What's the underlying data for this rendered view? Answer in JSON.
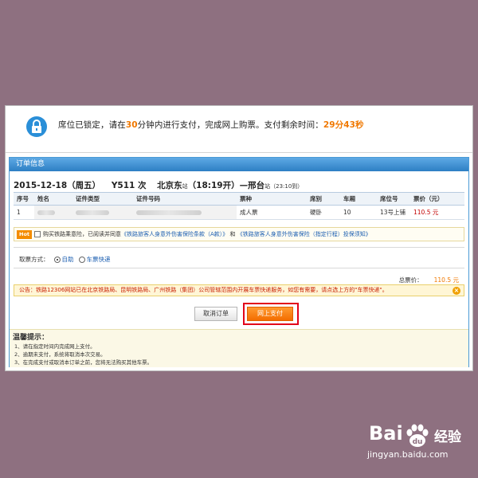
{
  "banner": {
    "text_before": "席位已锁定，请在",
    "minutes": "30",
    "text_after": "分钟内进行支付，完成网上购票。支付剩余时间：",
    "remaining": "29分43秒"
  },
  "panel": {
    "header": "订单信息"
  },
  "train": {
    "date": "2015-12-18（周五）",
    "number": "Y511 次",
    "from": "北京东",
    "from_suffix": "站",
    "depart": "（18:19开）",
    "dash": "—",
    "to": "邢台",
    "to_suffix": "站",
    "arrive": "（23:10到）"
  },
  "table": {
    "headers": [
      "序号",
      "姓名",
      "证件类型",
      "证件号码",
      "票种",
      "席别",
      "车厢",
      "席位号",
      "票价（元）"
    ],
    "row": {
      "index": "1",
      "ticket_type": "成人票",
      "seat_class": "硬卧",
      "car": "10",
      "seat_no": "13号上铺",
      "price": "110.5 元"
    }
  },
  "insurance": {
    "badge": "Hot",
    "text": "购买铁路乘意险，已阅读并同意",
    "link1": "《铁路旅客人身意外伤害保险条款（A款）》",
    "and": "和",
    "link2": "《铁路旅客人身意外伤害保险（指定行程）投保须知》"
  },
  "fetch": {
    "label": "取票方式：",
    "option1": "自助",
    "option2": "车票快递"
  },
  "total": {
    "label": "总票价：",
    "amount": "110.5 元"
  },
  "notice": {
    "text": "公告：铁路12306网站已在北京铁路局、昆明铁路局、广州铁路（集团）公司管辖范围内开展车票快递服务，如您有需要，请点选上方的\"车票快递\"。",
    "close": "×"
  },
  "buttons": {
    "cancel": "取消订单",
    "pay": "网上支付"
  },
  "tips": {
    "title": "温馨提示：",
    "items": [
      "1、请在指定时间内完成网上支付。",
      "2、逾期未支付，系统将取消本次交易。",
      "3、在完成支付或取消本订单之前，您将无法购买其他车票。"
    ]
  },
  "watermark": {
    "brand_left": "Bai",
    "brand_right": "经验",
    "url": "jingyan.baidu.com"
  },
  "colors": {
    "accent": "#f07800",
    "panel_blue": "#2d7fc4",
    "highlight_red": "#e2001a"
  }
}
